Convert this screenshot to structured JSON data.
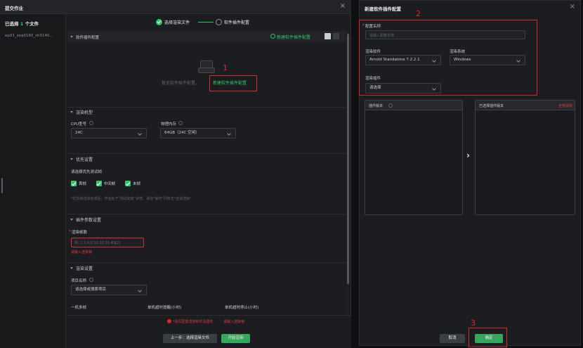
{
  "left_dialog": {
    "title": "提交作业",
    "close": "×",
    "selected_prefix": "已选择",
    "selected_count": "1",
    "selected_suffix": "个文件",
    "file_name": "ep01_seq0180_sh0140...",
    "steps": {
      "step1": "选择渲染文件",
      "step2": "软件插件配置"
    },
    "plugin_section": {
      "title": "软件插件配置",
      "new_link": "新建软件插件配置",
      "empty_text": "暂无软件插件配置，",
      "empty_link": "新建软件插件配置"
    },
    "render_model": {
      "title": "渲染机型",
      "cpu_label": "CPU型号",
      "cpu_value": "24C",
      "mem_label": "物理内存",
      "mem_value": "64GB（24C 空闲）"
    },
    "priority": {
      "title": "优先设置",
      "desc": "请选择优先测试帧",
      "opt1": "首帧",
      "opt2": "中间帧",
      "opt3": "末帧",
      "note": "*优先帧渲染完成后，作业处于\"测试完成\"状态，请在\"操作\"列单击\"全速渲染\""
    },
    "frames": {
      "title": "插件参数设置",
      "label": "渲染帧数",
      "placeholder": "例: 1,3,4,5,10-20,35-40[2]",
      "error": "请输入渲染帧"
    },
    "render_settings": {
      "title": "渲染设置",
      "project_label": "项目名称",
      "project_value": "请选择或搜索项目",
      "col1": "一机多帧",
      "col2": "单机超时提醒(小时)",
      "col3": "单机超时停止(小时)"
    },
    "footer": {
      "warning": "*请先配置渲染软件及插件",
      "warning2": "请输入渲染帧",
      "prev": "上一步：选择渲染文件",
      "submit": "开始渲染"
    }
  },
  "right_dialog": {
    "title": "新建软件插件配置",
    "close": "×",
    "name_label": "配置名称",
    "name_placeholder": "请输入配置名称",
    "software_label": "渲染软件",
    "software_value": "Arnold Standalone 7.2.2.1",
    "os_label": "渲染系统",
    "os_value": "Windows",
    "plugin_label": "渲染插件",
    "plugin_value": "请选择",
    "plugin_version_header": "插件版本",
    "selected_version_header": "已选择插件版本",
    "clear_all": "全部清除",
    "transfer_arrow": "›",
    "cancel": "取消",
    "confirm": "确定"
  },
  "annotations": {
    "a1": "1",
    "a2": "2",
    "a3": "3"
  },
  "colors": {
    "accent": "#35c46a",
    "annotation": "#d9252b",
    "panel": "#1c1d20"
  }
}
